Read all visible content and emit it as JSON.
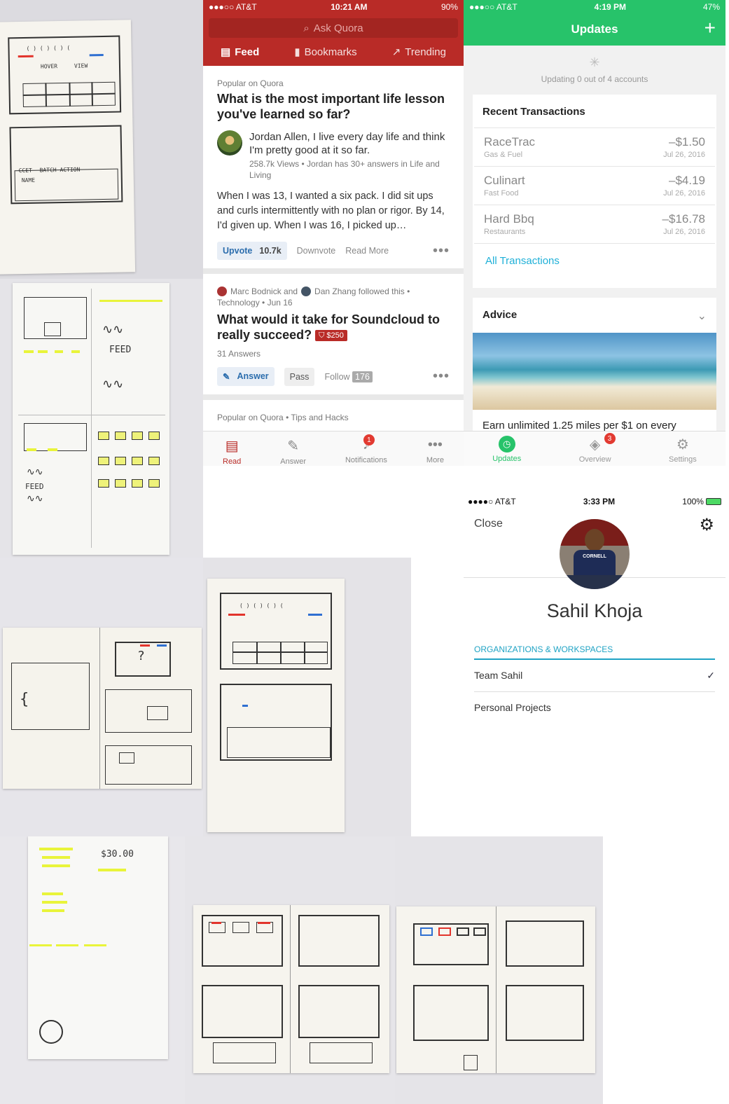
{
  "quora": {
    "status": {
      "carrier": "●●●○○ AT&T",
      "time": "10:21 AM",
      "battery": "90%"
    },
    "search_placeholder": "Ask Quora",
    "tabs": [
      "Feed",
      "Bookmarks",
      "Trending"
    ],
    "card1": {
      "source": "Popular on Quora",
      "question": "What is the most important life lesson you've learned so far?",
      "author": "Jordan Allen, I live every day life and think I'm pretty good at it so far.",
      "meta": "258.7k Views • Jordan has 30+ answers in Life and Living",
      "body": "When I was 13, I wanted a six pack. I did sit ups and curls intermittently with no plan or rigor. By 14, I'd given up. When I was 16, I picked up…",
      "upvote": "Upvote",
      "upvote_count": "10.7k",
      "downvote": "Downvote",
      "read_more": "Read More"
    },
    "card2": {
      "followers": "Marc Bodnick and",
      "follower2": "Dan Zhang followed this •",
      "topic": "Technology • Jun 16",
      "question": "What would it take for Soundcloud to really succeed?",
      "bounty": "$250",
      "answers": "31 Answers",
      "answer_btn": "Answer",
      "pass_btn": "Pass",
      "follow_btn": "Follow",
      "follow_count": "176"
    },
    "card3_source": "Popular on Quora • Tips and Hacks",
    "tabbar": {
      "read": "Read",
      "answer": "Answer",
      "notifications": "Notifications",
      "notifications_badge": "1",
      "more": "More"
    },
    "accent": "#b92b27"
  },
  "mint": {
    "status": {
      "carrier": "●●●○○ AT&T",
      "time": "4:19 PM",
      "battery": "47%"
    },
    "title": "Updates",
    "updating": "Updating 0 out of 4 accounts",
    "recent_title": "Recent Transactions",
    "transactions": [
      {
        "name": "RaceTrac",
        "category": "Gas & Fuel",
        "amount": "–$1.50",
        "date": "Jul 26, 2016"
      },
      {
        "name": "Culinart",
        "category": "Fast Food",
        "amount": "–$4.19",
        "date": "Jul 26, 2016"
      },
      {
        "name": "Hard Bbq",
        "category": "Restaurants",
        "amount": "–$16.78",
        "date": "Jul 26, 2016"
      }
    ],
    "all_transactions": "All Transactions",
    "advice_title": "Advice",
    "advice_text": "Earn unlimited 1.25 miles per $1 on every",
    "tabbar": {
      "updates": "Updates",
      "overview": "Overview",
      "overview_badge": "3",
      "settings": "Settings"
    },
    "accent": "#27c36a"
  },
  "profile": {
    "status": {
      "carrier": "●●●●○ AT&T",
      "time": "3:33 PM",
      "battery": "100%"
    },
    "close": "Close",
    "shirt_text": "CORNELL",
    "name": "Sahil Khoja",
    "section": "ORGANIZATIONS & WORKSPACES",
    "orgs": [
      "Team Sahil",
      "Personal Projects"
    ],
    "checkmark": "✓",
    "accent": "#1fa3c4"
  },
  "sketches": {
    "labels": [
      "HOVER",
      "VIEW",
      "FEED",
      "FEED",
      "CCET",
      "BATCH ACTION",
      "NAME",
      "?",
      "$30.00"
    ]
  }
}
